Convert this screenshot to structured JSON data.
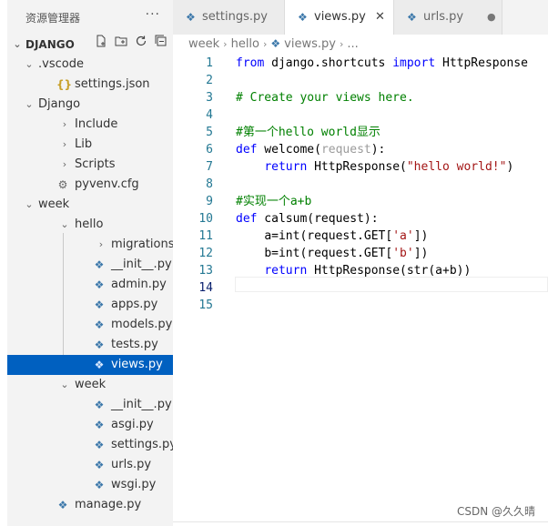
{
  "explorer": {
    "title": "资源管理器",
    "more": "···",
    "root": {
      "label": "DJANGO"
    },
    "root_actions": [
      "new-file",
      "new-folder",
      "refresh",
      "collapse-all"
    ]
  },
  "tree": [
    {
      "label": ".vscode",
      "type": "folder",
      "expanded": true
    },
    {
      "label": "settings.json",
      "type": "json",
      "icon_text": "{}"
    },
    {
      "label": "Django",
      "type": "folder",
      "expanded": true
    },
    {
      "label": "Include",
      "type": "folder",
      "expanded": false
    },
    {
      "label": "Lib",
      "type": "folder",
      "expanded": false
    },
    {
      "label": "Scripts",
      "type": "folder",
      "expanded": false
    },
    {
      "label": "pyvenv.cfg",
      "type": "gear"
    },
    {
      "label": "week",
      "type": "folder",
      "expanded": true
    },
    {
      "label": "hello",
      "type": "folder",
      "expanded": true
    },
    {
      "label": "migrations",
      "type": "folder",
      "expanded": false
    },
    {
      "label": "__init__.py",
      "type": "py"
    },
    {
      "label": "admin.py",
      "type": "py"
    },
    {
      "label": "apps.py",
      "type": "py"
    },
    {
      "label": "models.py",
      "type": "py"
    },
    {
      "label": "tests.py",
      "type": "py"
    },
    {
      "label": "views.py",
      "type": "py",
      "selected": true
    },
    {
      "label": "week",
      "type": "folder",
      "expanded": true
    },
    {
      "label": "__init__.py",
      "type": "py"
    },
    {
      "label": "asgi.py",
      "type": "py"
    },
    {
      "label": "settings.py",
      "type": "py"
    },
    {
      "label": "urls.py",
      "type": "py"
    },
    {
      "label": "wsgi.py",
      "type": "py"
    },
    {
      "label": "manage.py",
      "type": "py"
    }
  ],
  "tabs": [
    {
      "label": "settings.py",
      "active": false
    },
    {
      "label": "views.py",
      "active": true,
      "close": "✕"
    },
    {
      "label": "urls.py",
      "active": false,
      "modified": "●"
    }
  ],
  "breadcrumb": [
    "week",
    "hello",
    "views.py",
    "..."
  ],
  "line_numbers": [
    "1",
    "2",
    "3",
    "4",
    "5",
    "6",
    "7",
    "8",
    "9",
    "10",
    "11",
    "12",
    "13",
    "14",
    "15"
  ],
  "current_line": "14",
  "code": {
    "l1": {
      "kw1": "from",
      "mod": " django.shortcuts ",
      "kw2": "import",
      "name": " HttpResponse"
    },
    "l3": "# Create your views here.",
    "l5": "#第一个hello world显示",
    "l6": {
      "kw": "def",
      "name": " welcome(",
      "param": "request",
      "end": "):"
    },
    "l7": {
      "indent": "    ",
      "kw": "return",
      "call": " HttpResponse(",
      "str": "\"hello world!\"",
      "end": ")"
    },
    "l9": "#实现一个a+b",
    "l10": {
      "kw": "def",
      "name": " calsum(request):"
    },
    "l11": {
      "indent": "    ",
      "pre": "a=int(request.GET[",
      "str": "'a'",
      "end": "])"
    },
    "l12": {
      "indent": "    ",
      "pre": "b=int(request.GET[",
      "str": "'b'",
      "end": "])"
    },
    "l13": {
      "indent": "    ",
      "kw": "return",
      "call": " HttpResponse(str(a+b))"
    }
  },
  "watermark": "CSDN @久久晴"
}
